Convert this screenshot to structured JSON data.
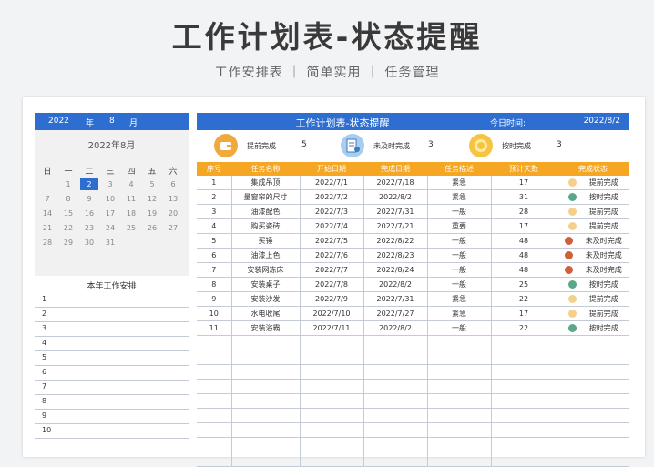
{
  "header": {
    "title": "工作计划表-状态提醒",
    "subtitle": "工作安排表 ｜ 简单实用 ｜ 任务管理"
  },
  "calendar": {
    "year": "2022",
    "year_label": "年",
    "month": "8",
    "month_label": "月",
    "title": "2022年8月",
    "weekdays": [
      "日",
      "一",
      "二",
      "三",
      "四",
      "五",
      "六"
    ],
    "weeks": [
      [
        "",
        "1",
        "2",
        "3",
        "4",
        "5",
        "6"
      ],
      [
        "7",
        "8",
        "9",
        "10",
        "11",
        "12",
        "13"
      ],
      [
        "14",
        "15",
        "16",
        "17",
        "18",
        "19",
        "20"
      ],
      [
        "21",
        "22",
        "23",
        "24",
        "25",
        "26",
        "27"
      ],
      [
        "28",
        "29",
        "30",
        "31",
        "",
        "",
        ""
      ]
    ],
    "selected_day": "2",
    "accent_color": "#2e6ed0"
  },
  "yearly_plan": {
    "title": "本年工作安排",
    "rows": [
      "1",
      "2",
      "3",
      "4",
      "5",
      "6",
      "7",
      "8",
      "9",
      "10"
    ]
  },
  "main": {
    "title": "工作计划表-状态提醒",
    "date_label": "今日时间:",
    "date_value": "2022/8/2"
  },
  "stats": [
    {
      "label": "提前完成",
      "count": "5",
      "icon": "wallet-icon",
      "color": "#f2a93b"
    },
    {
      "label": "未及时完成",
      "count": "3",
      "icon": "document-user-icon",
      "color": "#7bb3e0"
    },
    {
      "label": "按时完成",
      "count": "3",
      "icon": "clock-badge-icon",
      "color": "#f5c542"
    }
  ],
  "table": {
    "columns": [
      "序号",
      "任务名称",
      "开始日期",
      "完成日期",
      "任务描述",
      "预计天数",
      "完成状态"
    ],
    "header_color": "#f5a623",
    "rows": [
      {
        "no": "1",
        "name": "集成吊顶",
        "start": "2022/7/1",
        "end": "2022/7/18",
        "desc": "紧急",
        "days": "17",
        "status": "提前完成",
        "dot": "#f5d08a"
      },
      {
        "no": "2",
        "name": "量窗帘的尺寸",
        "start": "2022/7/2",
        "end": "2022/8/2",
        "desc": "紧急",
        "days": "31",
        "status": "按时完成",
        "dot": "#5aa88a"
      },
      {
        "no": "3",
        "name": "油漆配色",
        "start": "2022/7/3",
        "end": "2022/7/31",
        "desc": "一般",
        "days": "28",
        "status": "提前完成",
        "dot": "#f5d08a"
      },
      {
        "no": "4",
        "name": "购买瓷砖",
        "start": "2022/7/4",
        "end": "2022/7/21",
        "desc": "重要",
        "days": "17",
        "status": "提前完成",
        "dot": "#f5d08a"
      },
      {
        "no": "5",
        "name": "买锤",
        "start": "2022/7/5",
        "end": "2022/8/22",
        "desc": "一般",
        "days": "48",
        "status": "未及时完成",
        "dot": "#d0603a"
      },
      {
        "no": "6",
        "name": "油漆上色",
        "start": "2022/7/6",
        "end": "2022/8/23",
        "desc": "一般",
        "days": "48",
        "status": "未及时完成",
        "dot": "#d0603a"
      },
      {
        "no": "7",
        "name": "安装网冻床",
        "start": "2022/7/7",
        "end": "2022/8/24",
        "desc": "一般",
        "days": "48",
        "status": "未及时完成",
        "dot": "#d0603a"
      },
      {
        "no": "8",
        "name": "安装桌子",
        "start": "2022/7/8",
        "end": "2022/8/2",
        "desc": "一般",
        "days": "25",
        "status": "按时完成",
        "dot": "#5aa88a"
      },
      {
        "no": "9",
        "name": "安装沙发",
        "start": "2022/7/9",
        "end": "2022/7/31",
        "desc": "紧急",
        "days": "22",
        "status": "提前完成",
        "dot": "#f5d08a"
      },
      {
        "no": "10",
        "name": "水电收尾",
        "start": "2022/7/10",
        "end": "2022/7/27",
        "desc": "紧急",
        "days": "17",
        "status": "提前完成",
        "dot": "#f5d08a"
      },
      {
        "no": "11",
        "name": "安装浴霸",
        "start": "2022/7/11",
        "end": "2022/8/2",
        "desc": "一般",
        "days": "22",
        "status": "按时完成",
        "dot": "#5aa88a"
      }
    ],
    "empty_rows": 9
  }
}
